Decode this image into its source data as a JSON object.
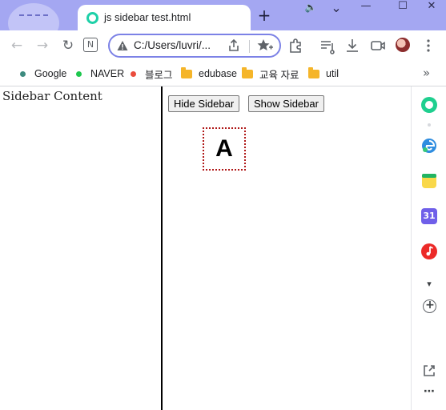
{
  "tab": {
    "title": "js sidebar test.html",
    "new_tab_label": "+"
  },
  "window_controls": {
    "minimize": "—",
    "maximize": "☐",
    "close": "✕",
    "volume": "🔈",
    "tab_search": "⌄"
  },
  "toolbar": {
    "back": "←",
    "forward": "→",
    "reload": "↻",
    "home": "N",
    "url": "C:/Users/luvri/..."
  },
  "bookmarks": [
    {
      "label": "Google",
      "kind": "dot",
      "color": "#3d8b7f"
    },
    {
      "label": "NAVER",
      "kind": "dot",
      "color": "#1ec74e"
    },
    {
      "label": "블로그",
      "kind": "dot",
      "color": "#ea4c3c"
    },
    {
      "label": "edubase",
      "kind": "folder",
      "color": "#f5b529"
    },
    {
      "label": "교육 자료",
      "kind": "folder",
      "color": "#f5b529"
    },
    {
      "label": "util",
      "kind": "folder",
      "color": "#f5b529"
    }
  ],
  "bookmarks_more": "»",
  "page": {
    "sidebar_text": "Sidebar Content",
    "hide_button": "Hide Sidebar",
    "show_button": "Show Sidebar",
    "box_label": "A"
  },
  "side_panel": {
    "calendar_number": "31",
    "add_label": "+",
    "more_label": "⋯",
    "collapse_label": "▾"
  },
  "colors": {
    "accent": "#7c82e6",
    "title_bar": "#a4a7f2",
    "favicon": "#1ed0a8",
    "box_border": "#b01818"
  }
}
